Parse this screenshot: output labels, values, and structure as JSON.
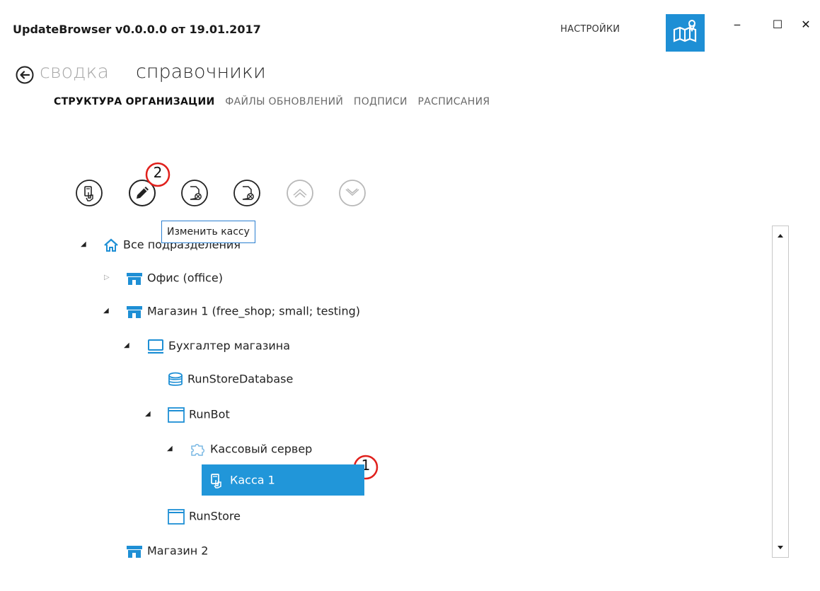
{
  "window": {
    "title": "UpdateBrowser v0.0.0.0 от 19.01.2017",
    "settings_label": "НАСТРОЙКИ",
    "minimize_label": "‒",
    "maximize_label": "☐",
    "close_label": "✕",
    "accent_color": "#1e8fd5"
  },
  "breadcrumb": {
    "summary": "сводка",
    "current": "справочники"
  },
  "tabs": [
    {
      "label": "СТРУКТУРА ОРГАНИЗАЦИИ",
      "active": true
    },
    {
      "label": "ФАЙЛЫ ОБНОВЛЕНИЙ",
      "active": false
    },
    {
      "label": "ПОДПИСИ",
      "active": false
    },
    {
      "label": "РАСПИСАНИЯ",
      "active": false
    }
  ],
  "toolbar": {
    "tooltip": "Изменить кассу",
    "buttons": [
      {
        "name": "add-cash-register",
        "icon": "cash-register-icon"
      },
      {
        "name": "edit-cash-register",
        "icon": "pencil-icon"
      },
      {
        "name": "delete-item",
        "icon": "delete-file-icon"
      },
      {
        "name": "delete-item-2",
        "icon": "delete-file-icon"
      },
      {
        "name": "move-up",
        "icon": "chevron-up-icon"
      },
      {
        "name": "move-down",
        "icon": "chevron-down-icon"
      }
    ]
  },
  "markers": {
    "one": "1",
    "two": "2"
  },
  "tree": {
    "root": "Все подразделения",
    "office": "Офис (office)",
    "shop1": "Магазин 1 (free_shop; small; testing)",
    "accountant": "Бухгалтер магазина",
    "database": "RunStoreDatabase",
    "runbot": "RunBot",
    "cash_server": "Кассовый сервер",
    "register1": "Касса 1",
    "runstore": "RunStore",
    "shop2": "Магазин 2"
  },
  "colors": {
    "selected_bg": "#2196d9",
    "icon_blue": "#1e8fd5",
    "marker_red": "#e0201c"
  }
}
